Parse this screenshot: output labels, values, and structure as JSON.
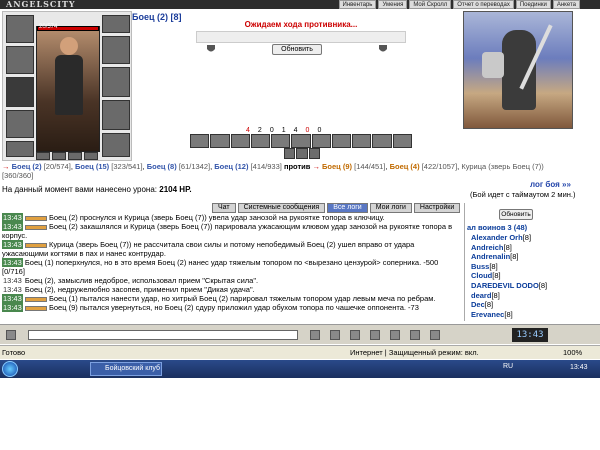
{
  "header": {
    "logo": "ANGELSCITY",
    "nav": [
      "Инвентарь",
      "Умения",
      "Мой Скролл",
      "Отчет о переводах",
      "Поединки",
      "Анкета"
    ]
  },
  "player": {
    "name": "Боец (2) [8]",
    "hp": "20/574"
  },
  "battle": {
    "waiting": "Ожидаем хода противника...",
    "refresh": "Обновить",
    "stats": [
      "4",
      "2",
      "0",
      "1",
      "4",
      "0",
      "0"
    ]
  },
  "teams": {
    "left": [
      {
        "name": "Боец (2)",
        "hp": "[20/574]"
      },
      {
        "name": "Боец (15)",
        "hp": "[323/541]"
      },
      {
        "name": "Боец (8)",
        "hp": "[61/1342]"
      },
      {
        "name": "Боец (12)",
        "hp": "[414/933]"
      }
    ],
    "versus": "против",
    "right": [
      {
        "name": "Боец (9)",
        "hp": "[144/451]"
      },
      {
        "name": "Боец (4)",
        "hp": "[422/1057]"
      },
      {
        "name": "Курица (зверь Боец (7))",
        "hp": "[360/360]"
      }
    ]
  },
  "damage_text": "На данный момент вами нанесено урона:",
  "damage_value": "2104 HP.",
  "log_link": "лог боя »»",
  "timeout_text": "(Бой идет с таймаутом 2 мин.)",
  "tabs": [
    "Чат",
    "Системные сообщения",
    "Все логи",
    "Мои логи",
    "Настройки"
  ],
  "chat": [
    {
      "time": "13:43",
      "text": "Боец (2) проснулся и Курица (зверь Боец (7)) увела удар занозой на рукоятке топора в ключицу."
    },
    {
      "time": "13:43",
      "text": "Боец (2) закашлялся и Курица (зверь Боец (7)) парировала ужасающим клювом удар занозой на рукоятке топора в корпус."
    },
    {
      "time": "13:43",
      "text": "Курица (зверь Боец (7)) не рассчитала свои силы и потому непобедимый Боец (2) ушел вправо от удара ужасающими когтями в пах и нанес контрудар."
    },
    {
      "time": "13:43",
      "text": "Боец (1) поперхнулся, но в это время Боец (2) нанес удар тяжелым топором по <вырезано цензурой> соперника. -500 [0/716]"
    },
    {
      "time": "13:43",
      "text": "Боец (2), замыслив недоброе, использовал прием \"Скрытая сила\"."
    },
    {
      "time": "13:43",
      "text": "Боец (2), недружелюбно засопев, применил прием \"Дикая удача\"."
    },
    {
      "time": "13:43",
      "text": "Боец (1) пытался нанести удар, но хитрый Боец (2) парировал тяжелым топором удар левым меча по ребрам."
    },
    {
      "time": "13:43",
      "text": "Боец (9) пытался увернуться, но Боец (2) сдуру приложил удар обухом топора по чашечке оппонента. -73"
    }
  ],
  "online": {
    "refresh": "Обновить",
    "title": "ал воинов 3 (48)",
    "users": [
      {
        "name": "Alexander Orh",
        "lv": "[8]"
      },
      {
        "name": "Andreich",
        "lv": "[8]"
      },
      {
        "name": "Andrenalin",
        "lv": "[8]"
      },
      {
        "name": "Buss",
        "lv": "[8]"
      },
      {
        "name": "Cloud",
        "lv": "[8]"
      },
      {
        "name": "DAREDEVIL DODO",
        "lv": "[8]"
      },
      {
        "name": "deard",
        "lv": "[8]"
      },
      {
        "name": "Dec",
        "lv": "[8]"
      },
      {
        "name": "Erevanec",
        "lv": "[8]"
      }
    ]
  },
  "clock": "13:43",
  "statusbar": {
    "left": "Готово",
    "zone": "Интернет | Защищенный режим: вкл.",
    "zoom": "100%"
  },
  "taskbar": {
    "item": "Бойцовский клуб - ...",
    "lang": "RU",
    "time": "13:43"
  }
}
